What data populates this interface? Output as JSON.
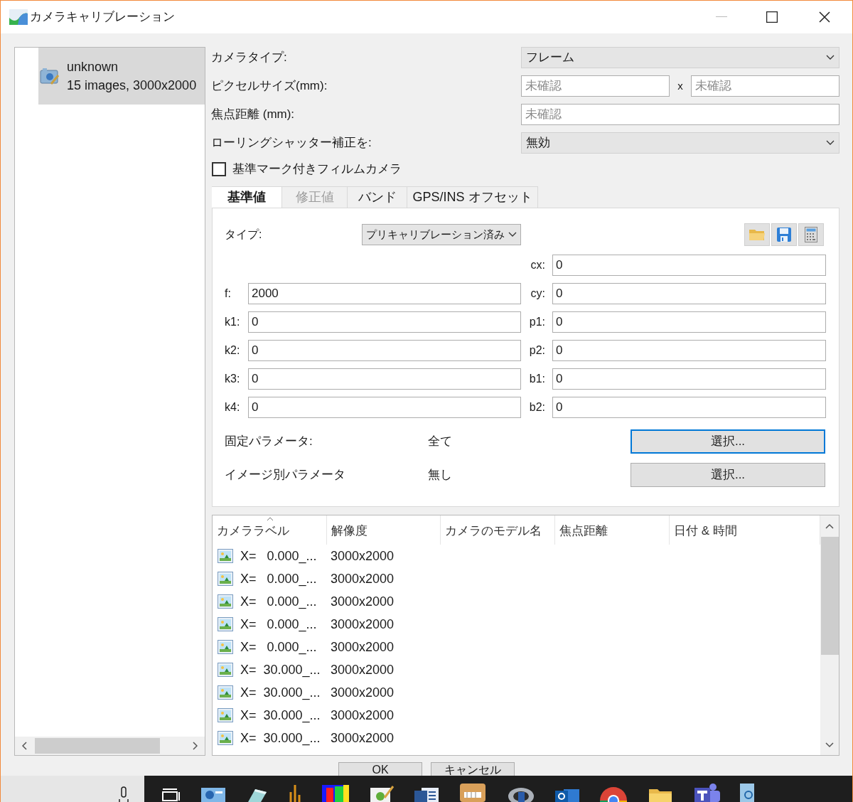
{
  "window": {
    "title": "カメラキャリブレーション"
  },
  "camera_list": [
    {
      "name": "unknown",
      "detail": "15 images, 3000x2000",
      "selected": true
    }
  ],
  "form": [
    {
      "label": "カメラタイプ:",
      "kind": "dropdown",
      "value": "フレーム"
    },
    {
      "label": "ピクセルサイズ(mm):",
      "kind": "pair",
      "placeholders": [
        "未確認",
        "未確認"
      ],
      "separator": "x"
    },
    {
      "label": "焦点距離 (mm):",
      "kind": "text",
      "placeholder": "未確認"
    },
    {
      "label": "ローリングシャッター補正を:",
      "kind": "dropdown",
      "value": "無効"
    }
  ],
  "fiducial_checkbox": {
    "label": "基準マーク付きフィルムカメラ",
    "checked": false
  },
  "tabs": [
    {
      "label": "基準値",
      "selected": true,
      "disabled": false
    },
    {
      "label": "修正値",
      "selected": false,
      "disabled": true
    },
    {
      "label": "バンド",
      "selected": false,
      "disabled": false
    },
    {
      "label": "GPS/INS オフセット",
      "selected": false,
      "disabled": false
    }
  ],
  "type_row": {
    "label": "タイプ:",
    "value": "プリキャリブレーション済み"
  },
  "params_left": [
    {
      "label": "f:",
      "value": "2000"
    },
    {
      "label": "k1:",
      "value": "0"
    },
    {
      "label": "k2:",
      "value": "0"
    },
    {
      "label": "k3:",
      "value": "0"
    },
    {
      "label": "k4:",
      "value": "0"
    }
  ],
  "params_right": [
    {
      "label": "cx:",
      "value": "0"
    },
    {
      "label": "cy:",
      "value": "0"
    },
    {
      "label": "p1:",
      "value": "0"
    },
    {
      "label": "p2:",
      "value": "0"
    },
    {
      "label": "b1:",
      "value": "0"
    },
    {
      "label": "b2:",
      "value": "0"
    }
  ],
  "fixed_rows": [
    {
      "label": "固定パラメータ:",
      "value": "全て",
      "button": "選択...",
      "focused": true
    },
    {
      "label": "イメージ別パラメータ",
      "value": "無し",
      "button": "選択...",
      "focused": false
    }
  ],
  "table": {
    "columns": [
      {
        "label": "カメララベル",
        "sorted": true
      },
      {
        "label": "解像度",
        "sorted": false
      },
      {
        "label": "カメラのモデル名",
        "sorted": false
      },
      {
        "label": "焦点距離",
        "sorted": false
      },
      {
        "label": "日付 & 時間",
        "sorted": false
      }
    ],
    "rows": [
      {
        "label": "X=   0.000_...",
        "resolution": "3000x2000"
      },
      {
        "label": "X=   0.000_...",
        "resolution": "3000x2000"
      },
      {
        "label": "X=   0.000_...",
        "resolution": "3000x2000"
      },
      {
        "label": "X=   0.000_...",
        "resolution": "3000x2000"
      },
      {
        "label": "X=   0.000_...",
        "resolution": "3000x2000"
      },
      {
        "label": "X=  30.000_...",
        "resolution": "3000x2000"
      },
      {
        "label": "X=  30.000_...",
        "resolution": "3000x2000"
      },
      {
        "label": "X=  30.000_...",
        "resolution": "3000x2000"
      },
      {
        "label": "X=  30.000_...",
        "resolution": "3000x2000"
      }
    ]
  },
  "buttons": [
    "OK",
    "キャンセル"
  ]
}
